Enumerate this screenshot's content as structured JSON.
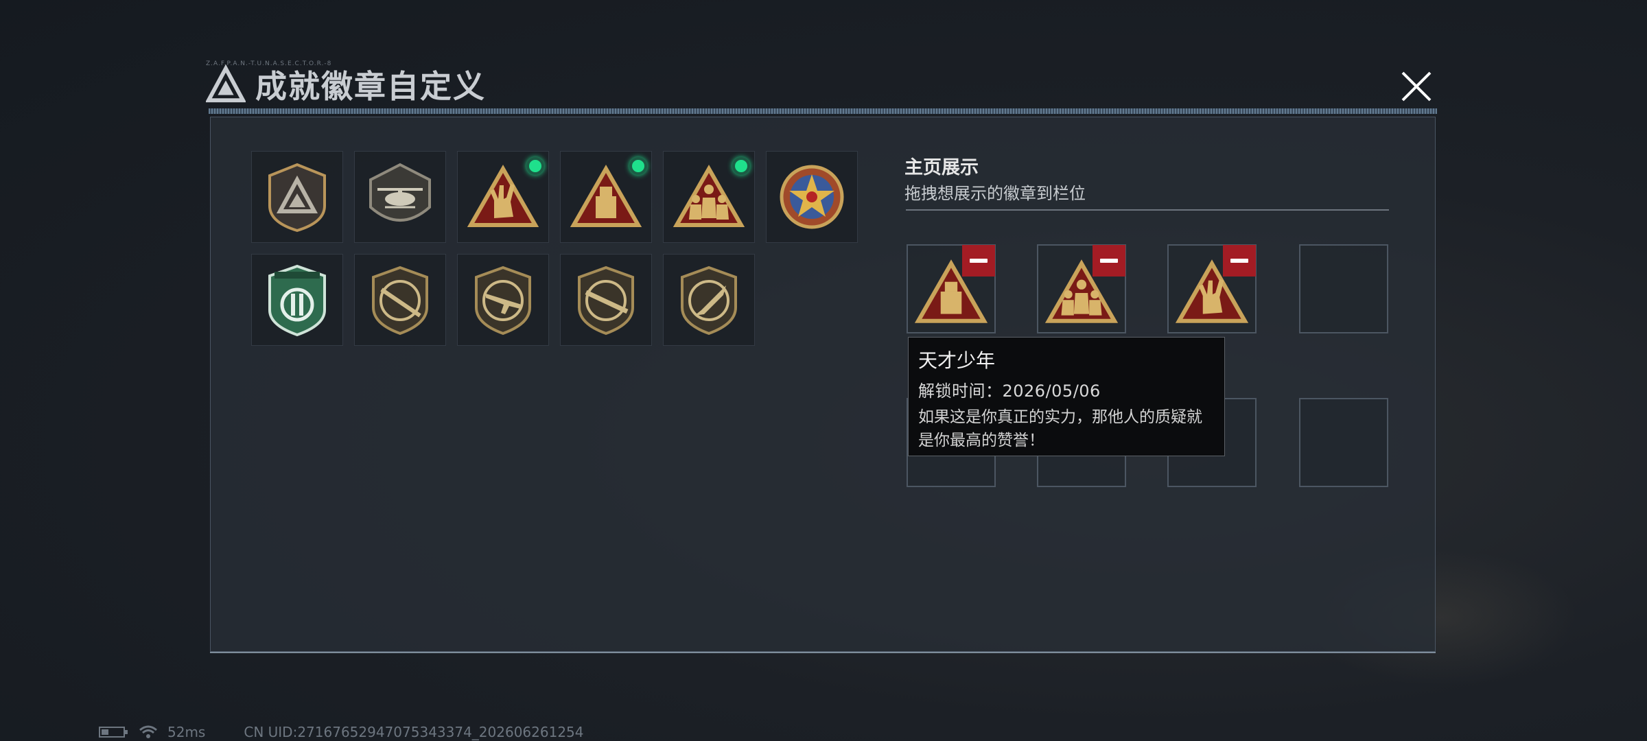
{
  "window": {
    "title": "成就徽章自定义",
    "tiny_text": "Z.A.F.P.A.N.-T.U.N.A.S.E.C.T.O.R.-8"
  },
  "badges": [
    {
      "id": "b1",
      "icon": "apex-triangle-shield",
      "new": false
    },
    {
      "id": "b2",
      "icon": "helicopter-shield",
      "new": false
    },
    {
      "id": "b3",
      "icon": "rock-hand-triangle",
      "new": true
    },
    {
      "id": "b4",
      "icon": "usb-triangle",
      "new": true
    },
    {
      "id": "b5",
      "icon": "squad-triangle",
      "new": true
    },
    {
      "id": "b6",
      "icon": "star-medal",
      "new": false
    },
    {
      "id": "b7",
      "icon": "green-shield",
      "new": false
    },
    {
      "id": "b8",
      "icon": "sniper-rifle-shield",
      "new": false
    },
    {
      "id": "b9",
      "icon": "assault-rifle-shield",
      "new": false
    },
    {
      "id": "b10",
      "icon": "shotgun-shield",
      "new": false
    },
    {
      "id": "b11",
      "icon": "knife-shield",
      "new": false
    }
  ],
  "showcase": {
    "title": "主页展示",
    "description": "拖拽想展示的徽章到栏位",
    "slots": [
      {
        "badge": "usb-triangle",
        "filled": true
      },
      {
        "badge": "squad-triangle",
        "filled": true
      },
      {
        "badge": "rock-hand-triangle",
        "filled": true
      },
      {
        "badge": "",
        "filled": false
      },
      {
        "badge": "",
        "filled": false
      },
      {
        "badge": "",
        "filled": false
      },
      {
        "badge": "",
        "filled": false
      },
      {
        "badge": "",
        "filled": false
      }
    ]
  },
  "tooltip": {
    "name": "天才少年",
    "unlock_time": "解锁时间：2026/05/06",
    "description_line1": "如果这是你真正的实力，那他人的质疑就",
    "description_line2": "是你最高的赞誉！"
  },
  "status_bar": {
    "ping": "52ms",
    "uid": "CN UID:271676529470753433​74_202606261254"
  },
  "colors": {
    "new_dot": "#1fe08c",
    "remove": "#a31c24",
    "gold": "#c9a35a",
    "red_triangle": "#7a1a16"
  }
}
